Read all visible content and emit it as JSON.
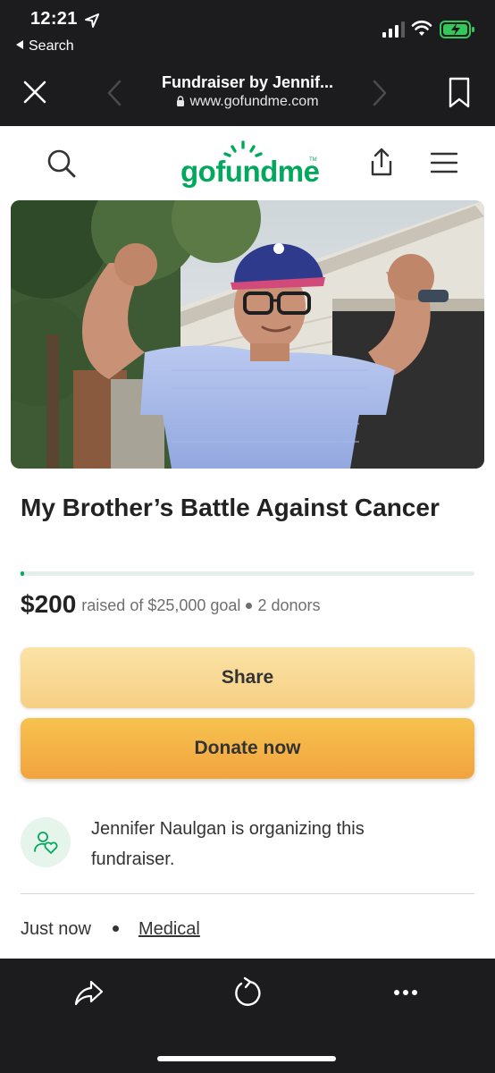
{
  "status_bar": {
    "time": "12:21",
    "back_app": "Search"
  },
  "browser": {
    "page_title": "Fundraiser by Jennif...",
    "url": "www.gofundme.com"
  },
  "site": {
    "logo_text": "gofundme",
    "logo_tm": "TM"
  },
  "campaign": {
    "title": "My Brother’s Battle Against Cancer",
    "raised": "$200",
    "goal_text": "raised of $25,000 goal",
    "donors": "2 donors",
    "progress_percent": 0.8
  },
  "buttons": {
    "share": "Share",
    "donate": "Donate now"
  },
  "organizer": {
    "text": "Jennifer Naulgan is organizing this fundraiser."
  },
  "meta": {
    "time": "Just now",
    "category": "Medical"
  },
  "colors": {
    "brand_green": "#02a95c",
    "chrome_dark": "#1c1c1e",
    "battery_green": "#34c759"
  },
  "icons": [
    "location-arrow-icon",
    "signal-icon",
    "wifi-icon",
    "battery-icon",
    "close-icon",
    "chevron-left-icon",
    "chevron-right-icon",
    "bookmark-icon",
    "search-icon",
    "share-icon",
    "menu-icon",
    "organizer-heart-icon",
    "toolbar-share-icon",
    "reload-icon",
    "more-icon"
  ]
}
